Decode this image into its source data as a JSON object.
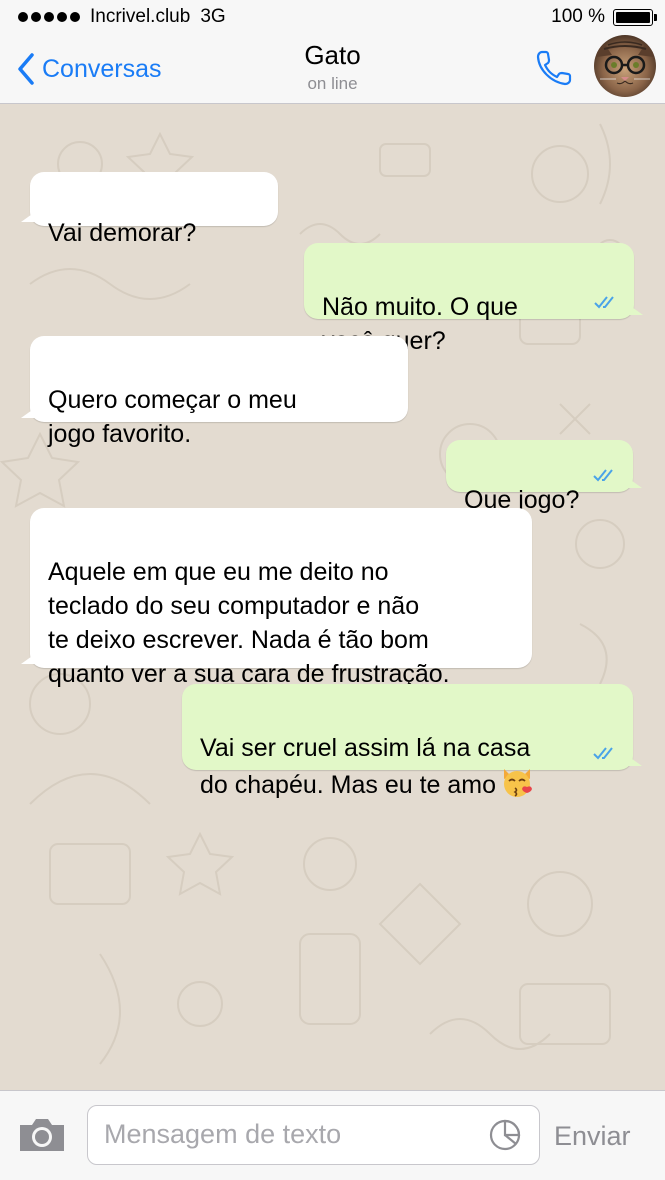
{
  "status_bar": {
    "carrier": "Incrivel.club",
    "network": "3G",
    "battery": "100 %",
    "battery_level": 1.0
  },
  "header": {
    "back_label": "Conversas",
    "title": "Gato",
    "subtitle": "on line",
    "phone_icon": "phone-icon",
    "avatar": "cat-avatar"
  },
  "messages": [
    {
      "side": "in",
      "text": "Vai demorar?"
    },
    {
      "side": "out",
      "text": "Não muito. O que\nvocê quer?",
      "status": "read"
    },
    {
      "side": "in",
      "text": "Quero começar o meu\njogo favorito."
    },
    {
      "side": "out",
      "text": "Que jogo?",
      "status": "read"
    },
    {
      "side": "in",
      "text": "Aquele em que eu me deito no\nteclado do seu computador e não\nte deixo escrever. Nada é tão bom\nquanto ver a sua cara de frustração."
    },
    {
      "side": "out",
      "text": "Vai ser cruel assim lá na casa\ndo chapéu. Mas eu te amo",
      "emoji": "kissing-cat-emoji",
      "status": "read"
    }
  ],
  "input_bar": {
    "camera_icon": "camera-icon",
    "placeholder": "Mensagem de texto",
    "sticker_icon": "sticker-icon",
    "send_label": "Enviar"
  },
  "colors": {
    "accent": "#1a7cf6",
    "outgoing_bubble": "#e2f8c8",
    "incoming_bubble": "#ffffff",
    "chat_background": "#e3dbd0",
    "read_ticks": "#4aa3e8"
  }
}
